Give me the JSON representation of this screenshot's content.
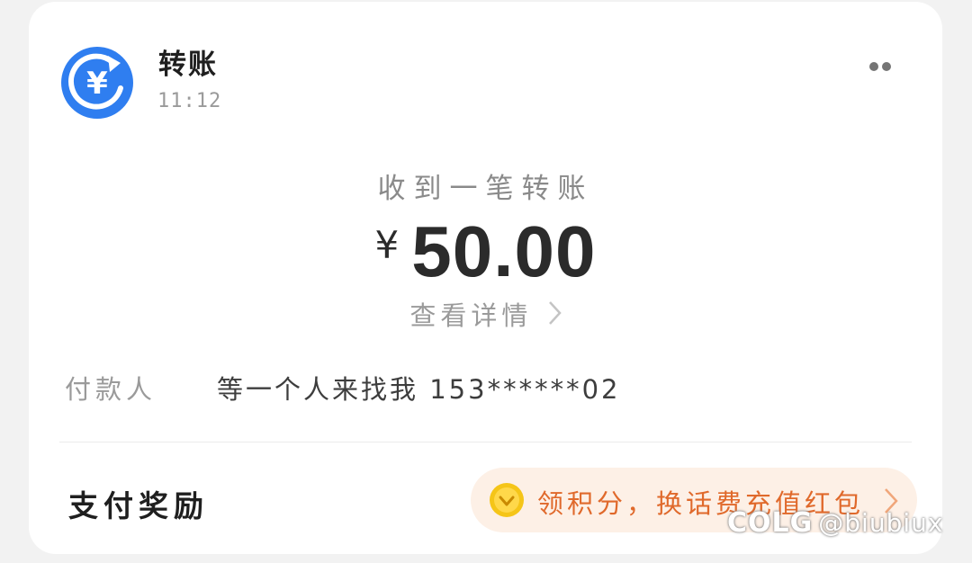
{
  "header": {
    "title": "转账",
    "time": "11:12",
    "app_icon": "yuan-transfer-icon",
    "more_icon": "more-dots-icon"
  },
  "transfer": {
    "status": "收到一笔转账",
    "currency": "¥",
    "amount": "50.00",
    "details_link": "查看详情"
  },
  "payer": {
    "label": "付款人",
    "name": "等一个人来找我 153******02"
  },
  "reward": {
    "title": "支付奖励",
    "promo": "领积分，换话费充值红包",
    "coin_icon": "gold-coin-icon"
  },
  "watermark": {
    "brand": "COLG",
    "handle": "@biubiux"
  },
  "colors": {
    "accent_blue": "#2f7ef0",
    "promo_orange": "#e0692b",
    "promo_bg": "#fdf0e6"
  }
}
